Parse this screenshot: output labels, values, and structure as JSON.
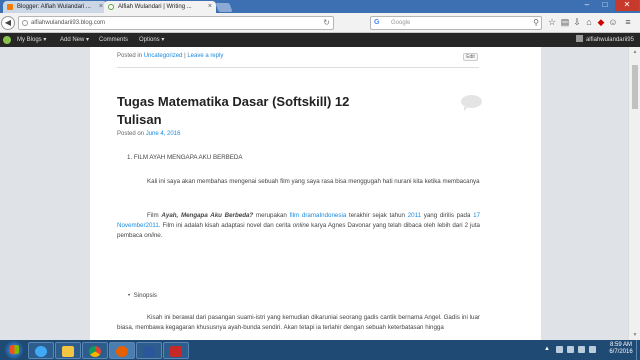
{
  "browser": {
    "tabs": [
      {
        "title": "Blogger: Alfiah Wulandari ...",
        "close": "×"
      },
      {
        "title": "Alfiah Wulandari | Writing ...",
        "close": "×"
      }
    ],
    "window_controls": {
      "minimize": "–",
      "maximize": "□",
      "close": "✕"
    },
    "url": "alfiahwulandarii93.blog.com",
    "search_placeholder": "Google",
    "toolbar_icons": [
      "star-icon",
      "clipboard-icon",
      "download-icon",
      "home-icon",
      "notifications-icon",
      "smiley-icon",
      "menu-icon"
    ]
  },
  "adminbar": {
    "items": [
      "My Blogs",
      "Add New",
      "Comments",
      "Options"
    ],
    "dropdown_arrow": "▾",
    "user": "alfiahwulandarii95"
  },
  "post": {
    "meta_top": {
      "prefix": "Posted in",
      "category": "Uncategorized",
      "sep": "|",
      "reply": "Leave a reply"
    },
    "edit": "Edit",
    "title": "Tugas Matematika Dasar (Softskill) 12 Tulisan",
    "posted_on_prefix": "Posted on",
    "posted_on_date": "June 4, 2016",
    "list_item_1": "1.  FILM AYAH MENGAPA AKU BERBEDA",
    "para1": "Kali ini saya akan membahas mengenai sebuah film yang saya rasa bisa menggugah hati nurani kita ketika membacanya",
    "para2": {
      "t1": "Film ",
      "t2": "Ayah, Mengapa Aku Berbeda?",
      "t3": "  merupakan ",
      "link1": "film drama",
      "link2": "Indonesia",
      "t4": " terakhir sejak tahun ",
      "link3": "2011",
      "t5": " yang dirilis pada ",
      "link4": "17 November",
      "link5": "2011",
      "t6": ".  Film ini adalah kisah adaptasi novel dan cerita ",
      "t7": "online",
      "t8": " karya Agnes Davonar yang telah dibaca oleh lebih dari 2 juta pembaca ",
      "t9": "online",
      "t10": "."
    },
    "bullet": "•",
    "sinopsis": "Sinopsis",
    "para3": "Kisah ini berawal dari pasangan suami-istri yang kemudian dikaruniai seorang gadis cantik bernama Angel. Gadis ini luar biasa, membawa kegagaran khususnya ayah-bunda sendiri. Akan tetapi ia terlahir dengan sebuah keterbatasan hingga"
  },
  "taskbar": {
    "apps": [
      "internet-explorer",
      "file-explorer",
      "chrome",
      "firefox",
      "word",
      "acrobat"
    ],
    "tray_arrow": "▲",
    "time": "8:59 AM",
    "date": "6/7/2016"
  },
  "colors": {
    "link": "#1b8be0",
    "adminbar": "#262626",
    "taskbar": "#1e4a73",
    "tabstrip": "#3d6fb3"
  }
}
